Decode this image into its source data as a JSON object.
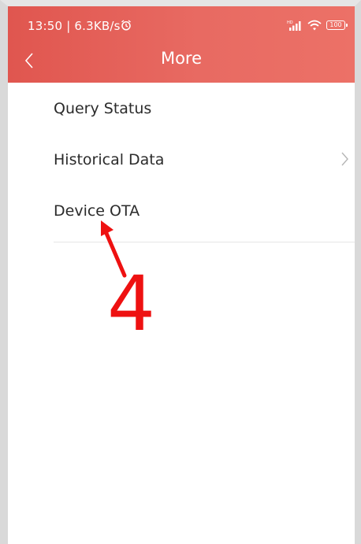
{
  "status_bar": {
    "time_speed": "13:50 | 6.3KB/s",
    "battery_level": "100",
    "icons": [
      "alarm-icon",
      "signal-icon",
      "wifi-icon",
      "battery-icon"
    ]
  },
  "header": {
    "title": "More",
    "background_color": "#e8645c"
  },
  "menu": {
    "items": [
      {
        "label": "Query Status",
        "has_chevron": false
      },
      {
        "label": "Historical Data",
        "has_chevron": true
      },
      {
        "label": "Device OTA",
        "has_chevron": false
      }
    ]
  },
  "annotation": {
    "step_number": "4",
    "color": "#ee1111"
  }
}
